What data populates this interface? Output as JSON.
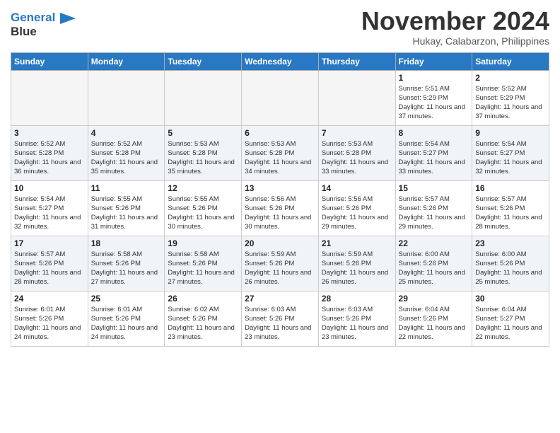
{
  "header": {
    "logo_line1": "General",
    "logo_line2": "Blue",
    "month_title": "November 2024",
    "location": "Hukay, Calabarzon, Philippines"
  },
  "weekdays": [
    "Sunday",
    "Monday",
    "Tuesday",
    "Wednesday",
    "Thursday",
    "Friday",
    "Saturday"
  ],
  "weeks": [
    [
      {
        "day": "",
        "sunrise": "",
        "sunset": "",
        "daylight": ""
      },
      {
        "day": "",
        "sunrise": "",
        "sunset": "",
        "daylight": ""
      },
      {
        "day": "",
        "sunrise": "",
        "sunset": "",
        "daylight": ""
      },
      {
        "day": "",
        "sunrise": "",
        "sunset": "",
        "daylight": ""
      },
      {
        "day": "",
        "sunrise": "",
        "sunset": "",
        "daylight": ""
      },
      {
        "day": "1",
        "sunrise": "Sunrise: 5:51 AM",
        "sunset": "Sunset: 5:29 PM",
        "daylight": "Daylight: 11 hours and 37 minutes."
      },
      {
        "day": "2",
        "sunrise": "Sunrise: 5:52 AM",
        "sunset": "Sunset: 5:29 PM",
        "daylight": "Daylight: 11 hours and 37 minutes."
      }
    ],
    [
      {
        "day": "3",
        "sunrise": "Sunrise: 5:52 AM",
        "sunset": "Sunset: 5:28 PM",
        "daylight": "Daylight: 11 hours and 36 minutes."
      },
      {
        "day": "4",
        "sunrise": "Sunrise: 5:52 AM",
        "sunset": "Sunset: 5:28 PM",
        "daylight": "Daylight: 11 hours and 35 minutes."
      },
      {
        "day": "5",
        "sunrise": "Sunrise: 5:53 AM",
        "sunset": "Sunset: 5:28 PM",
        "daylight": "Daylight: 11 hours and 35 minutes."
      },
      {
        "day": "6",
        "sunrise": "Sunrise: 5:53 AM",
        "sunset": "Sunset: 5:28 PM",
        "daylight": "Daylight: 11 hours and 34 minutes."
      },
      {
        "day": "7",
        "sunrise": "Sunrise: 5:53 AM",
        "sunset": "Sunset: 5:28 PM",
        "daylight": "Daylight: 11 hours and 33 minutes."
      },
      {
        "day": "8",
        "sunrise": "Sunrise: 5:54 AM",
        "sunset": "Sunset: 5:27 PM",
        "daylight": "Daylight: 11 hours and 33 minutes."
      },
      {
        "day": "9",
        "sunrise": "Sunrise: 5:54 AM",
        "sunset": "Sunset: 5:27 PM",
        "daylight": "Daylight: 11 hours and 32 minutes."
      }
    ],
    [
      {
        "day": "10",
        "sunrise": "Sunrise: 5:54 AM",
        "sunset": "Sunset: 5:27 PM",
        "daylight": "Daylight: 11 hours and 32 minutes."
      },
      {
        "day": "11",
        "sunrise": "Sunrise: 5:55 AM",
        "sunset": "Sunset: 5:26 PM",
        "daylight": "Daylight: 11 hours and 31 minutes."
      },
      {
        "day": "12",
        "sunrise": "Sunrise: 5:55 AM",
        "sunset": "Sunset: 5:26 PM",
        "daylight": "Daylight: 11 hours and 30 minutes."
      },
      {
        "day": "13",
        "sunrise": "Sunrise: 5:56 AM",
        "sunset": "Sunset: 5:26 PM",
        "daylight": "Daylight: 11 hours and 30 minutes."
      },
      {
        "day": "14",
        "sunrise": "Sunrise: 5:56 AM",
        "sunset": "Sunset: 5:26 PM",
        "daylight": "Daylight: 11 hours and 29 minutes."
      },
      {
        "day": "15",
        "sunrise": "Sunrise: 5:57 AM",
        "sunset": "Sunset: 5:26 PM",
        "daylight": "Daylight: 11 hours and 29 minutes."
      },
      {
        "day": "16",
        "sunrise": "Sunrise: 5:57 AM",
        "sunset": "Sunset: 5:26 PM",
        "daylight": "Daylight: 11 hours and 28 minutes."
      }
    ],
    [
      {
        "day": "17",
        "sunrise": "Sunrise: 5:57 AM",
        "sunset": "Sunset: 5:26 PM",
        "daylight": "Daylight: 11 hours and 28 minutes."
      },
      {
        "day": "18",
        "sunrise": "Sunrise: 5:58 AM",
        "sunset": "Sunset: 5:26 PM",
        "daylight": "Daylight: 11 hours and 27 minutes."
      },
      {
        "day": "19",
        "sunrise": "Sunrise: 5:58 AM",
        "sunset": "Sunset: 5:26 PM",
        "daylight": "Daylight: 11 hours and 27 minutes."
      },
      {
        "day": "20",
        "sunrise": "Sunrise: 5:59 AM",
        "sunset": "Sunset: 5:26 PM",
        "daylight": "Daylight: 11 hours and 26 minutes."
      },
      {
        "day": "21",
        "sunrise": "Sunrise: 5:59 AM",
        "sunset": "Sunset: 5:26 PM",
        "daylight": "Daylight: 11 hours and 26 minutes."
      },
      {
        "day": "22",
        "sunrise": "Sunrise: 6:00 AM",
        "sunset": "Sunset: 5:26 PM",
        "daylight": "Daylight: 11 hours and 25 minutes."
      },
      {
        "day": "23",
        "sunrise": "Sunrise: 6:00 AM",
        "sunset": "Sunset: 5:26 PM",
        "daylight": "Daylight: 11 hours and 25 minutes."
      }
    ],
    [
      {
        "day": "24",
        "sunrise": "Sunrise: 6:01 AM",
        "sunset": "Sunset: 5:26 PM",
        "daylight": "Daylight: 11 hours and 24 minutes."
      },
      {
        "day": "25",
        "sunrise": "Sunrise: 6:01 AM",
        "sunset": "Sunset: 5:26 PM",
        "daylight": "Daylight: 11 hours and 24 minutes."
      },
      {
        "day": "26",
        "sunrise": "Sunrise: 6:02 AM",
        "sunset": "Sunset: 5:26 PM",
        "daylight": "Daylight: 11 hours and 23 minutes."
      },
      {
        "day": "27",
        "sunrise": "Sunrise: 6:03 AM",
        "sunset": "Sunset: 5:26 PM",
        "daylight": "Daylight: 11 hours and 23 minutes."
      },
      {
        "day": "28",
        "sunrise": "Sunrise: 6:03 AM",
        "sunset": "Sunset: 5:26 PM",
        "daylight": "Daylight: 11 hours and 23 minutes."
      },
      {
        "day": "29",
        "sunrise": "Sunrise: 6:04 AM",
        "sunset": "Sunset: 5:26 PM",
        "daylight": "Daylight: 11 hours and 22 minutes."
      },
      {
        "day": "30",
        "sunrise": "Sunrise: 6:04 AM",
        "sunset": "Sunset: 5:27 PM",
        "daylight": "Daylight: 11 hours and 22 minutes."
      }
    ]
  ]
}
